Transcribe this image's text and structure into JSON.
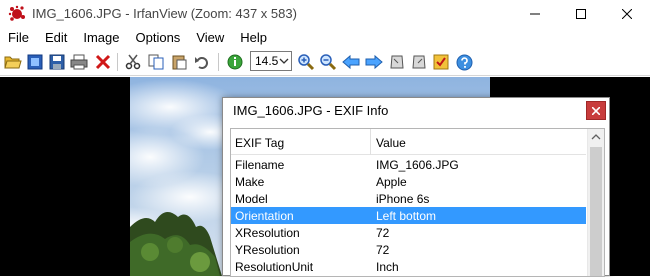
{
  "window": {
    "title": "IMG_1606.JPG - IrfanView (Zoom: 437 x 583)"
  },
  "menu": [
    "File",
    "Edit",
    "Image",
    "Options",
    "View",
    "Help"
  ],
  "toolbar": {
    "zoom_value": "14.5"
  },
  "exif_dialog": {
    "title": "IMG_1606.JPG - EXIF Info",
    "columns": [
      "EXIF Tag",
      "Value"
    ],
    "rows": [
      {
        "tag": "Filename",
        "value": "IMG_1606.JPG"
      },
      {
        "tag": "Make",
        "value": "Apple"
      },
      {
        "tag": "Model",
        "value": "iPhone 6s"
      },
      {
        "tag": "Orientation",
        "value": "Left bottom"
      },
      {
        "tag": "XResolution",
        "value": "72"
      },
      {
        "tag": "YResolution",
        "value": "72"
      },
      {
        "tag": "ResolutionUnit",
        "value": "Inch"
      }
    ],
    "selected_row": "Orientation",
    "selection_color": "#3399ff"
  },
  "colors": {
    "viewer_bg": "#000000",
    "close_button": "#c83c3c"
  }
}
